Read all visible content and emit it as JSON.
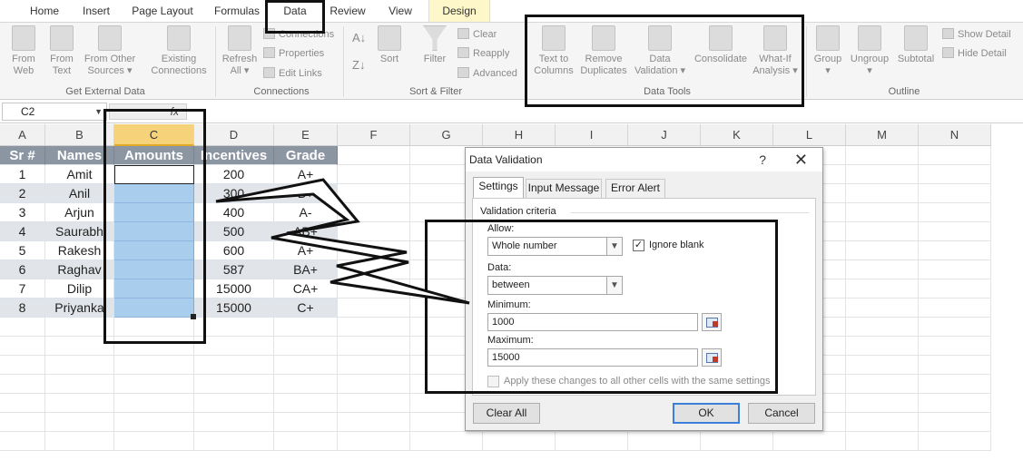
{
  "tabs": [
    "Home",
    "Insert",
    "Page Layout",
    "Formulas",
    "Data",
    "Review",
    "View",
    "Design"
  ],
  "ribbon": {
    "get_external": {
      "from_web": [
        "From",
        "Web"
      ],
      "from_text": [
        "From",
        "Text"
      ],
      "from_other": [
        "From Other",
        "Sources"
      ],
      "existing": [
        "Existing",
        "Connections"
      ],
      "group": "Get External Data"
    },
    "connections": {
      "refresh": [
        "Refresh",
        "All"
      ],
      "connections": "Connections",
      "properties": "Properties",
      "edit_links": "Edit Links",
      "group": "Connections"
    },
    "sort_filter": {
      "sort": "Sort",
      "filter": "Filter",
      "clear": "Clear",
      "reapply": "Reapply",
      "advanced": "Advanced",
      "group": "Sort & Filter"
    },
    "data_tools": {
      "text_to_columns": [
        "Text to",
        "Columns"
      ],
      "remove_duplicates": [
        "Remove",
        "Duplicates"
      ],
      "data_validation": [
        "Data",
        "Validation"
      ],
      "consolidate": "Consolidate",
      "what_if": [
        "What-If",
        "Analysis"
      ],
      "group": "Data Tools"
    },
    "outline": {
      "group_btn": "Group",
      "ungroup": "Ungroup",
      "subtotal": "Subtotal",
      "show_detail": "Show Detail",
      "hide_detail": "Hide Detail",
      "group": "Outline"
    }
  },
  "formula_bar": {
    "name_box": "C2",
    "fx": "fx"
  },
  "columns": [
    "A",
    "B",
    "C",
    "D",
    "E",
    "F",
    "G",
    "H",
    "I",
    "J",
    "K",
    "L",
    "M",
    "N"
  ],
  "table": {
    "headers": [
      "Sr #",
      "Names",
      "Amounts",
      "Incentives",
      "Grade"
    ],
    "rows": [
      [
        "1",
        "Amit",
        "",
        "200",
        "A+"
      ],
      [
        "2",
        "Anil",
        "",
        "300",
        "B+"
      ],
      [
        "3",
        "Arjun",
        "",
        "400",
        "A-"
      ],
      [
        "4",
        "Saurabh",
        "",
        "500",
        "AB+"
      ],
      [
        "5",
        "Rakesh",
        "",
        "600",
        "A+"
      ],
      [
        "6",
        "Raghav",
        "",
        "587",
        "BA+"
      ],
      [
        "7",
        "Dilip",
        "",
        "15000",
        "CA+"
      ],
      [
        "8",
        "Priyanka",
        "",
        "15000",
        "C+"
      ]
    ]
  },
  "dialog": {
    "title": "Data Validation",
    "help": "?",
    "close": "✕",
    "tabs": [
      "Settings",
      "Input Message",
      "Error Alert"
    ],
    "section": "Validation criteria",
    "allow_label": "Allow:",
    "allow_value": "Whole number",
    "ignore_blank": "Ignore blank",
    "ignore_blank_checked": true,
    "data_label": "Data:",
    "data_value": "between",
    "min_label": "Minimum:",
    "min_value": "1000",
    "max_label": "Maximum:",
    "max_value": "15000",
    "apply_all": "Apply these changes to all other cells with the same settings",
    "clear_all": "Clear All",
    "ok": "OK",
    "cancel": "Cancel"
  },
  "colors": {
    "highlight": "#111111",
    "selection": "#a9cdec",
    "header_fill": "#8c96a3",
    "active_column": "#f6d27a"
  }
}
